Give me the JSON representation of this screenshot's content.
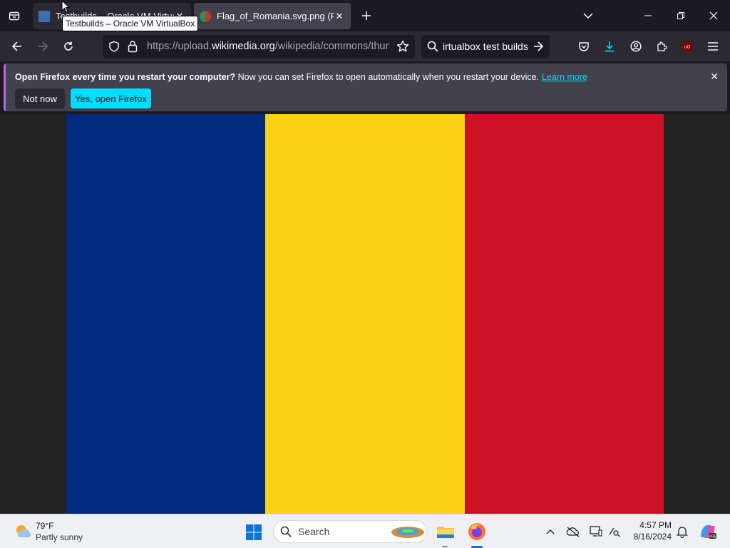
{
  "browser": {
    "tabs": [
      {
        "title": "Testbuilds – Oracle VM VirtualBox",
        "active": false
      },
      {
        "title": "Flag_of_Romania.svg.png (PNG Image",
        "active": true
      }
    ],
    "tooltip": "Testbuilds – Oracle VM VirtualBox",
    "url_prefix": "https://upload.",
    "url_domain": "wikimedia.org",
    "url_suffix": "/wikipedia/commons/thumb",
    "search_text": "irtualbox test builds"
  },
  "notification": {
    "bold_text": "Open Firefox every time you restart your computer?",
    "text": " Now you can set Firefox to open automatically when you restart your device.",
    "link": "Learn more",
    "not_now": "Not now",
    "yes": "Yes, open Firefox"
  },
  "flag": {
    "colors": [
      "#002b7f",
      "#fcd116",
      "#ce1126"
    ]
  },
  "taskbar": {
    "temperature": "79°F",
    "weather": "Partly sunny",
    "search_placeholder": "Search",
    "time": "4:57 PM",
    "date": "8/16/2024"
  },
  "icons": [
    "tab-list-icon",
    "chevron-down-icon",
    "minimize-icon",
    "restore-icon",
    "close-icon",
    "back-icon",
    "forward-icon",
    "reload-icon",
    "shield-icon",
    "lock-icon",
    "bookmark-star-icon",
    "search-icon",
    "go-arrow-icon",
    "pocket-icon",
    "download-icon",
    "account-icon",
    "extensions-icon",
    "ublock-icon",
    "menu-icon",
    "weather-icon",
    "windows-start-icon",
    "file-explorer-icon",
    "firefox-icon",
    "tray-chevron-icon",
    "onedrive-icon",
    "display-icon",
    "network-icon",
    "notification-bell-icon",
    "copilot-icon"
  ]
}
